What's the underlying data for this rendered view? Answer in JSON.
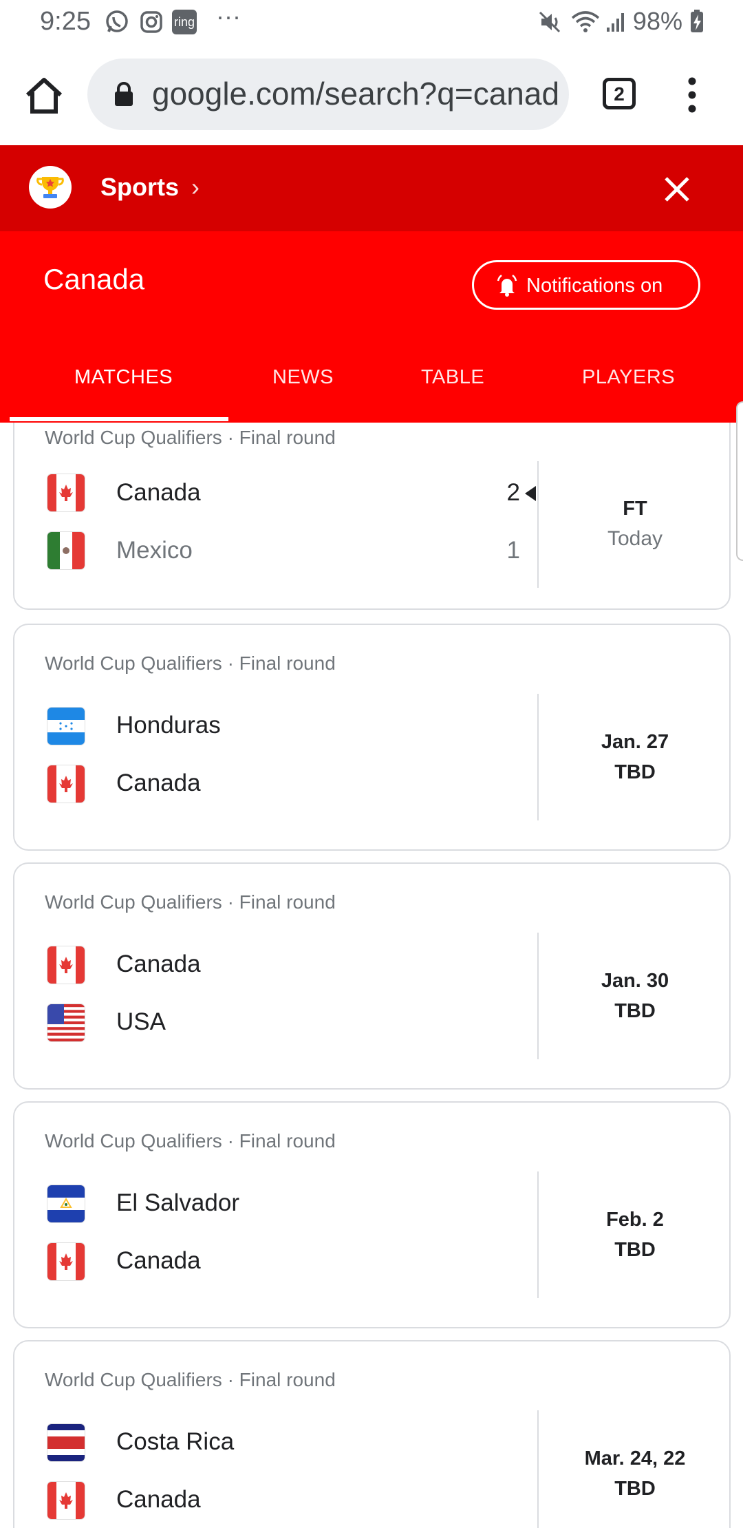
{
  "status_bar": {
    "time": "9:25",
    "battery": "98%",
    "notification_icons": [
      "whatsapp-icon",
      "instagram-icon",
      "ring-icon",
      "more-dots-icon"
    ],
    "ring_label": "ring",
    "more": "···"
  },
  "browser": {
    "url": "google.com/search?q=canad",
    "tab_count": "2"
  },
  "sports_header": {
    "label": "Sports",
    "chevron": "›",
    "team": "Canada",
    "notifications_label": "Notifications on",
    "tabs": [
      "MATCHES",
      "NEWS",
      "TABLE",
      "PLAYERS"
    ],
    "active_tab": "MATCHES"
  },
  "matches": [
    {
      "competition": "World Cup Qualifiers · Final round",
      "home": {
        "name": "Canada",
        "flag": "canada",
        "score": "2",
        "winner": true
      },
      "away": {
        "name": "Mexico",
        "flag": "mexico",
        "score": "1",
        "winner": false
      },
      "status_line1": "FT",
      "status_line2": "Today"
    },
    {
      "competition": "World Cup Qualifiers · Final round",
      "home": {
        "name": "Honduras",
        "flag": "honduras"
      },
      "away": {
        "name": "Canada",
        "flag": "canada"
      },
      "status_line1": "Jan. 27",
      "status_line2": "TBD"
    },
    {
      "competition": "World Cup Qualifiers · Final round",
      "home": {
        "name": "Canada",
        "flag": "canada"
      },
      "away": {
        "name": "USA",
        "flag": "usa"
      },
      "status_line1": "Jan. 30",
      "status_line2": "TBD"
    },
    {
      "competition": "World Cup Qualifiers · Final round",
      "home": {
        "name": "El Salvador",
        "flag": "el-salvador"
      },
      "away": {
        "name": "Canada",
        "flag": "canada"
      },
      "status_line1": "Feb. 2",
      "status_line2": "TBD"
    },
    {
      "competition": "World Cup Qualifiers · Final round",
      "home": {
        "name": "Costa Rica",
        "flag": "costa-rica"
      },
      "away": {
        "name": "Canada",
        "flag": "canada"
      },
      "status_line1": "Mar. 24, 22",
      "status_line2": "TBD"
    }
  ],
  "colors": {
    "header_dark_red": "#d50000",
    "header_red": "#ff0000",
    "card_border": "#dadce0",
    "muted_text": "#70757a"
  }
}
